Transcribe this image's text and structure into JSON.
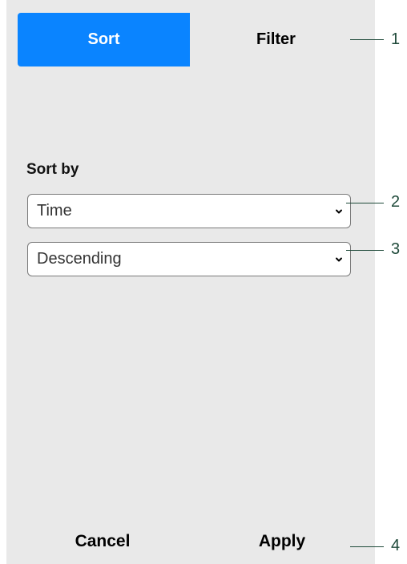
{
  "tabs": {
    "sort_label": "Sort",
    "filter_label": "Filter"
  },
  "sort_by": {
    "label": "Sort by",
    "field_value": "Time",
    "order_value": "Descending"
  },
  "footer": {
    "cancel_label": "Cancel",
    "apply_label": "Apply"
  },
  "callouts": [
    "1",
    "2",
    "3",
    "4"
  ],
  "colors": {
    "accent": "#0a84ff",
    "panel_bg": "#e9e9e9",
    "callout": "#1f4a3a"
  },
  "icons": {
    "select_chevron": "chevron-down-icon"
  }
}
